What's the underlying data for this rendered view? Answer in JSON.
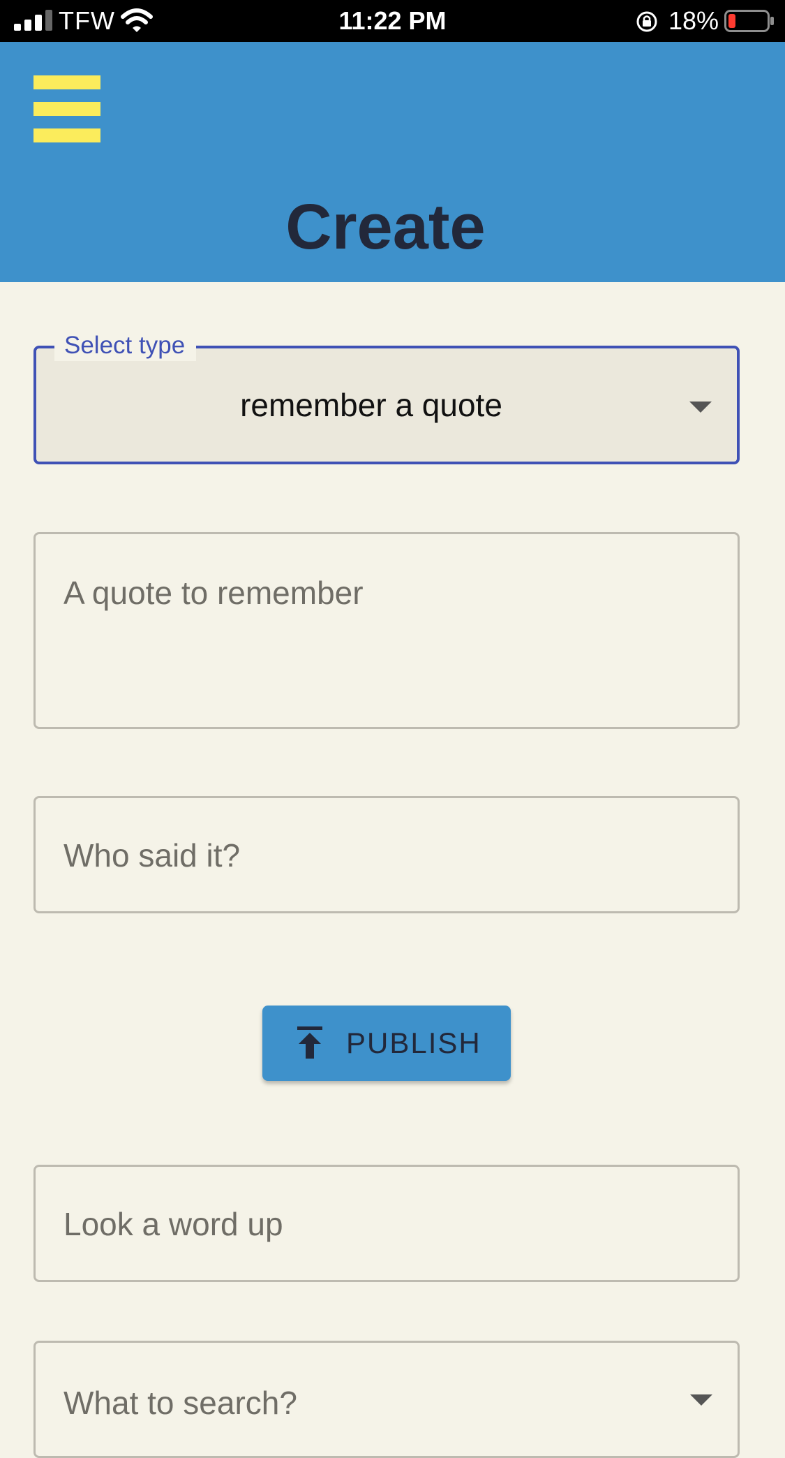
{
  "status_bar": {
    "carrier": "TFW",
    "time": "11:22 PM",
    "battery_percent": "18%",
    "battery_level": 0.18,
    "battery_color": "#ff3b30"
  },
  "header": {
    "title": "Create",
    "background_color": "#3e91cb",
    "menu_icon_color": "#fbec5c",
    "icons": {
      "menu": "hamburger-menu-icon"
    }
  },
  "form": {
    "type_select": {
      "label": "Select type",
      "value": "remember a quote",
      "accent_color": "#3f51b5"
    },
    "quote_field": {
      "placeholder": "A quote to remember",
      "value": ""
    },
    "author_field": {
      "placeholder": "Who said it?",
      "value": ""
    },
    "publish_button": {
      "label": "PUBLISH",
      "icon": "upload-icon"
    },
    "lookup_field": {
      "placeholder": "Look a word up",
      "value": ""
    },
    "search_select": {
      "placeholder": "What to search?"
    }
  }
}
